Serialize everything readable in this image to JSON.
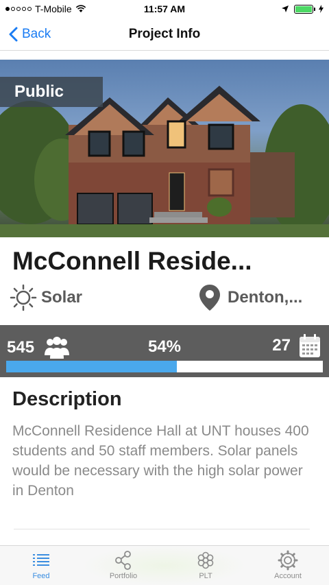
{
  "status_bar": {
    "carrier": "T-Mobile",
    "time": "11:57 AM"
  },
  "nav": {
    "back_label": "Back",
    "title": "Project Info"
  },
  "hero": {
    "badge": "Public",
    "image_icon": "house-photo"
  },
  "project": {
    "title": "McConnell Reside...",
    "type_label": "Solar",
    "location_label": "Denton,..."
  },
  "stats": {
    "supporters": "545",
    "percent": "54%",
    "progress_fraction": 0.54,
    "days": "27"
  },
  "description": {
    "heading": "Description",
    "body": "McConnell Residence Hall at UNT houses 400 students and 50 staff members. Solar panels would be necessary with the high solar power in Denton"
  },
  "tabs": [
    {
      "label": "Feed",
      "icon": "list-icon",
      "active": true
    },
    {
      "label": "Portfolio",
      "icon": "share-icon",
      "active": false
    },
    {
      "label": "PLT",
      "icon": "flower-icon",
      "active": false
    },
    {
      "label": "Account",
      "icon": "gear-icon",
      "active": false
    }
  ],
  "colors": {
    "accent": "#1a7cf3",
    "progress": "#4aa8ec",
    "stats_bg": "#5d5d5d"
  }
}
